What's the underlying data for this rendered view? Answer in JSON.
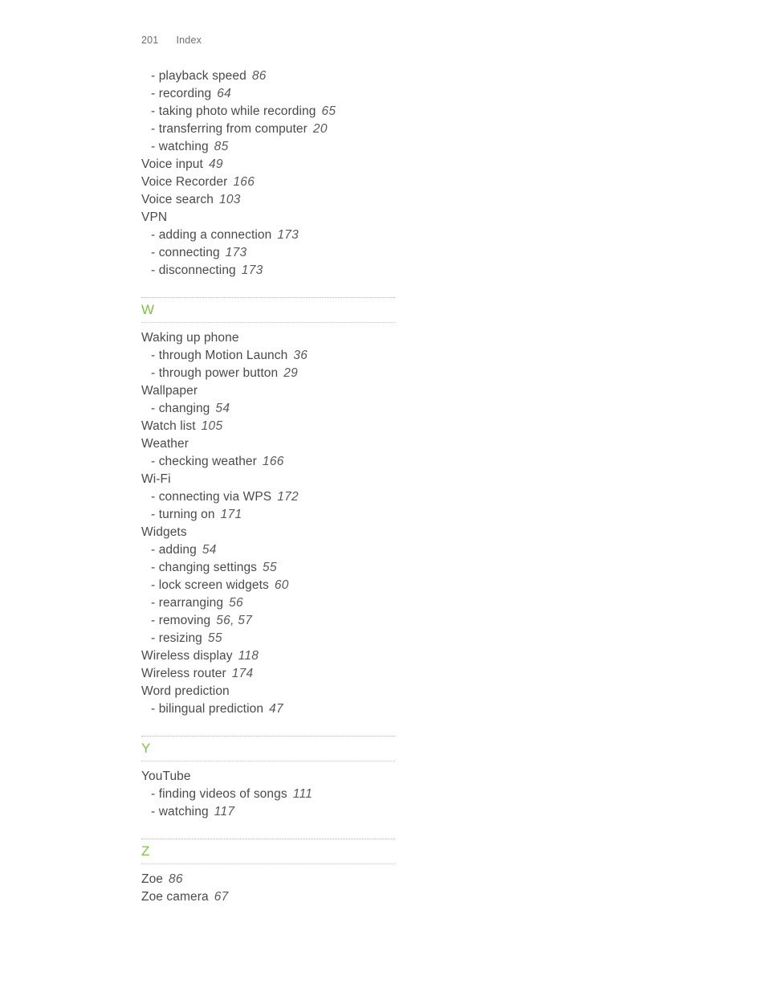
{
  "header": {
    "folio": "201",
    "section_title": "Index"
  },
  "theme": {
    "letter_color": "#7dc242",
    "text_color": "#4a4a4a",
    "rule_color": "#b3b3b3",
    "page_background": "#ffffff"
  },
  "blocks": [
    {
      "type": "entries",
      "entries": [
        {
          "level": "sub",
          "dash": "-",
          "label": "playback speed",
          "pages": "86"
        },
        {
          "level": "sub",
          "dash": "-",
          "label": "recording",
          "pages": "64"
        },
        {
          "level": "sub",
          "dash": "-",
          "label": "taking photo while recording",
          "pages": "65"
        },
        {
          "level": "sub",
          "dash": "-",
          "label": "transferring from computer",
          "pages": "20"
        },
        {
          "level": "sub",
          "dash": "-",
          "label": "watching",
          "pages": "85"
        },
        {
          "level": "main",
          "dash": "",
          "label": "Voice input",
          "pages": "49"
        },
        {
          "level": "main",
          "dash": "",
          "label": "Voice Recorder",
          "pages": "166"
        },
        {
          "level": "main",
          "dash": "",
          "label": "Voice search",
          "pages": "103"
        },
        {
          "level": "main",
          "dash": "",
          "label": "VPN",
          "pages": ""
        },
        {
          "level": "sub",
          "dash": "-",
          "label": "adding a connection",
          "pages": "173"
        },
        {
          "level": "sub",
          "dash": "-",
          "label": "connecting",
          "pages": "173"
        },
        {
          "level": "sub",
          "dash": "-",
          "label": "disconnecting",
          "pages": "173"
        }
      ]
    },
    {
      "type": "letter",
      "letter": "W"
    },
    {
      "type": "entries",
      "entries": [
        {
          "level": "main",
          "dash": "",
          "label": "Waking up phone",
          "pages": ""
        },
        {
          "level": "sub",
          "dash": "-",
          "label": "through Motion Launch",
          "pages": "36"
        },
        {
          "level": "sub",
          "dash": "-",
          "label": "through power button",
          "pages": "29"
        },
        {
          "level": "main",
          "dash": "",
          "label": "Wallpaper",
          "pages": ""
        },
        {
          "level": "sub",
          "dash": "-",
          "label": "changing",
          "pages": "54"
        },
        {
          "level": "main",
          "dash": "",
          "label": "Watch list",
          "pages": "105"
        },
        {
          "level": "main",
          "dash": "",
          "label": "Weather",
          "pages": ""
        },
        {
          "level": "sub",
          "dash": "-",
          "label": "checking weather",
          "pages": "166"
        },
        {
          "level": "main",
          "dash": "",
          "label": "Wi-Fi",
          "pages": ""
        },
        {
          "level": "sub",
          "dash": "-",
          "label": "connecting via WPS",
          "pages": "172"
        },
        {
          "level": "sub",
          "dash": "-",
          "label": "turning on",
          "pages": "171"
        },
        {
          "level": "main",
          "dash": "",
          "label": "Widgets",
          "pages": ""
        },
        {
          "level": "sub",
          "dash": "-",
          "label": "adding",
          "pages": "54"
        },
        {
          "level": "sub",
          "dash": "-",
          "label": "changing settings",
          "pages": "55"
        },
        {
          "level": "sub",
          "dash": "-",
          "label": "lock screen widgets",
          "pages": "60"
        },
        {
          "level": "sub",
          "dash": "-",
          "label": "rearranging",
          "pages": "56"
        },
        {
          "level": "sub",
          "dash": "-",
          "label": "removing",
          "pages": "56, 57"
        },
        {
          "level": "sub",
          "dash": "-",
          "label": "resizing",
          "pages": "55"
        },
        {
          "level": "main",
          "dash": "",
          "label": "Wireless display",
          "pages": "118"
        },
        {
          "level": "main",
          "dash": "",
          "label": "Wireless router",
          "pages": "174"
        },
        {
          "level": "main",
          "dash": "",
          "label": "Word prediction",
          "pages": ""
        },
        {
          "level": "sub",
          "dash": "-",
          "label": "bilingual prediction",
          "pages": "47"
        }
      ]
    },
    {
      "type": "letter",
      "letter": "Y"
    },
    {
      "type": "entries",
      "entries": [
        {
          "level": "main",
          "dash": "",
          "label": "YouTube",
          "pages": ""
        },
        {
          "level": "sub",
          "dash": "-",
          "label": "finding videos of songs",
          "pages": "111"
        },
        {
          "level": "sub",
          "dash": "-",
          "label": "watching",
          "pages": "117"
        }
      ]
    },
    {
      "type": "letter",
      "letter": "Z"
    },
    {
      "type": "entries",
      "entries": [
        {
          "level": "main",
          "dash": "",
          "label": "Zoe",
          "pages": "86"
        },
        {
          "level": "main",
          "dash": "",
          "label": "Zoe camera",
          "pages": "67"
        }
      ]
    }
  ]
}
